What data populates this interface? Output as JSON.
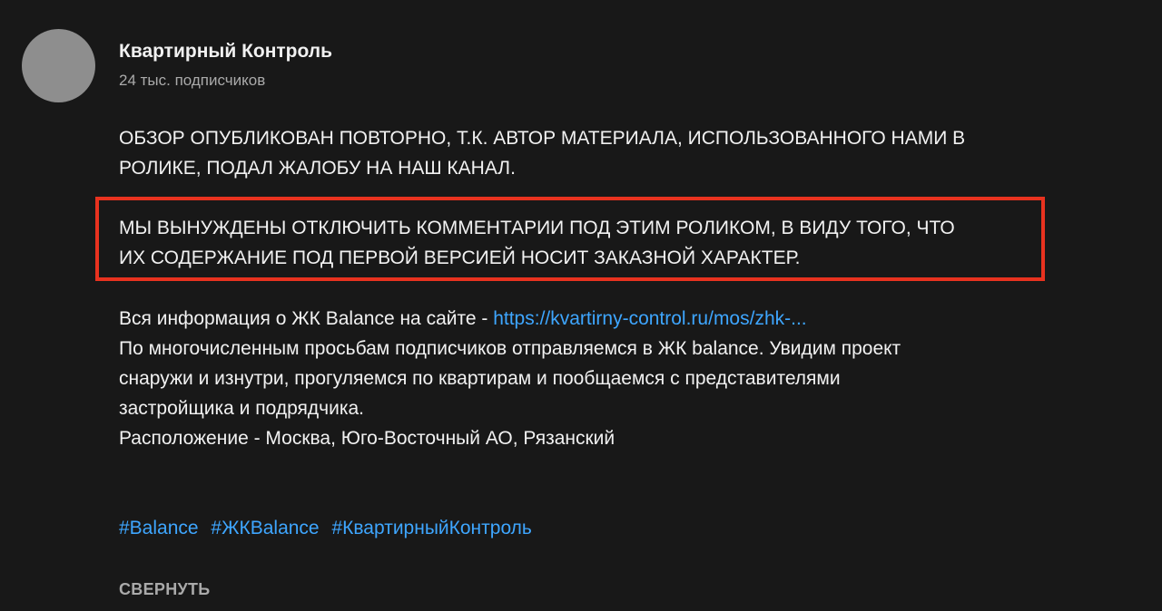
{
  "channel": {
    "name": "Квартирный Контроль",
    "subscribers": "24 тыс. подписчиков"
  },
  "description": {
    "notice_lines": [
      "ОБЗОР ОПУБЛИКОВАН ПОВТОРНО, Т.К. АВТОР МАТЕРИАЛА, ИСПОЛЬЗОВАННОГО НАМИ В",
      "РОЛИКЕ, ПОДАЛ ЖАЛОБУ НА НАШ КАНАЛ."
    ],
    "highlighted_lines": [
      "МЫ ВЫНУЖДЕНЫ ОТКЛЮЧИТЬ КОММЕНТАРИИ ПОД ЭТИМ РОЛИКОМ, В ВИДУ ТОГО, ЧТО",
      "ИХ СОДЕРЖАНИЕ ПОД ПЕРВОЙ ВЕРСИЕЙ НОСИТ ЗАКАЗНОЙ ХАРАКТЕР."
    ],
    "info_prefix": "Вся информация о ЖК Balance на сайте - ",
    "info_link": "https://kvartirny-control.ru/mos/zhk-...",
    "body_lines": [
      "По многочисленным просьбам подписчиков отправляемся в ЖК balance. Увидим проект",
      "снаружи и изнутри, прогуляемся по квартирам и пообщаемся с представителями",
      "застройщика и подрядчика.",
      "Расположение - Москва, Юго-Восточный АО, Рязанский"
    ],
    "hashtags": [
      "#Balance",
      "#ЖКBalance",
      "#КвартирныйКонтроль"
    ]
  },
  "collapse_label": "СВЕРНУТЬ",
  "colors": {
    "background": "#181818",
    "text": "#f1f1f1",
    "secondary_text": "#aaaaaa",
    "link": "#3ea6ff",
    "highlight_border": "#e8321f"
  }
}
